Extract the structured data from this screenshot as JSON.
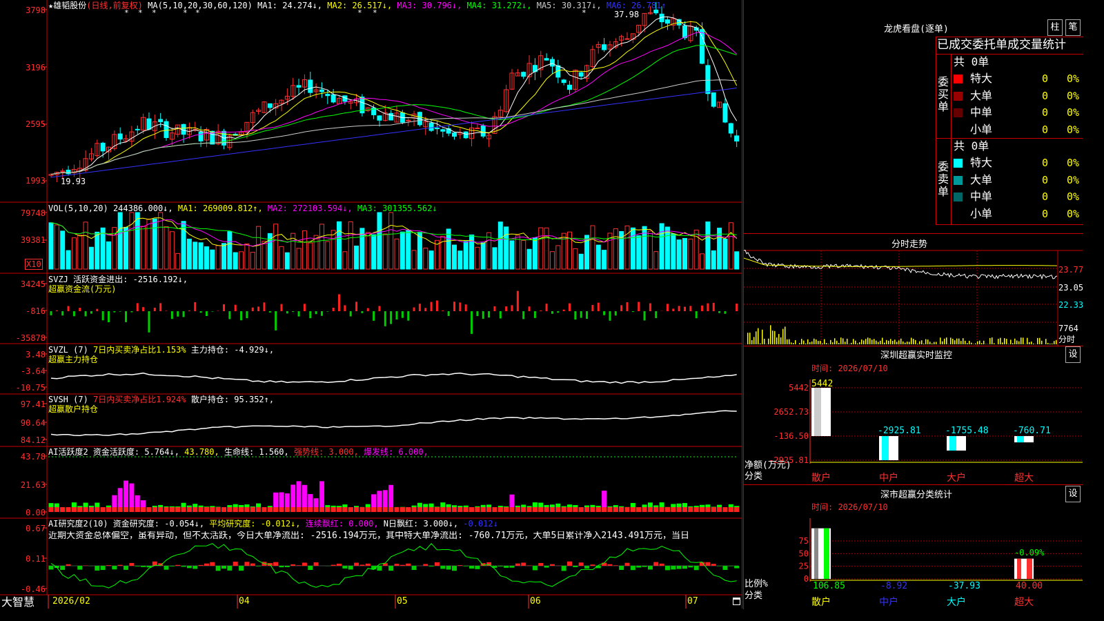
{
  "stock": {
    "name": "★雄韬股份",
    "period": "(日线,前复权)"
  },
  "main_header": {
    "ma_params": "MA(5,10,20,30,60,120)",
    "items": [
      {
        "label": "MA1: 24.274↓,",
        "color": "#ffffff"
      },
      {
        "label": "MA2: 26.517↓,",
        "color": "#ffff00"
      },
      {
        "label": "MA3: 30.796↓,",
        "color": "#ff00ff"
      },
      {
        "label": "MA4: 31.272↓,",
        "color": "#00ff00"
      },
      {
        "label": "MA5: 30.317↓,",
        "color": "#cccccc"
      },
      {
        "label": "MA6: 26.781↑",
        "color": "#3333ff"
      }
    ]
  },
  "main_axis": [
    "3798",
    "3196",
    "2595",
    "1993"
  ],
  "main_labels": {
    "high": "37.98",
    "low": "19.93"
  },
  "vol_header": {
    "params": "VOL(5,10,20)",
    "items": [
      {
        "label": "244386.000↓,",
        "color": "#ffffff"
      },
      {
        "label": "MA1: 269009.812↑,",
        "color": "#ffff00"
      },
      {
        "label": "MA2: 272103.594↓,",
        "color": "#ff00ff"
      },
      {
        "label": "MA3: 301355.562↓",
        "color": "#00ff00"
      }
    ]
  },
  "vol_axis": [
    "79748",
    "39381"
  ],
  "vol_unit": "X10",
  "svzj": {
    "line1": "SVZJ  活跃资金进出: -2516.192↓,",
    "line2": "超赢资金流(万元)",
    "axis": [
      "34245",
      "-816",
      "-35878"
    ]
  },
  "svzl": {
    "p1": "SVZL (7)",
    "p2": "7日内买卖净占比1.153%",
    "p3": "主力持仓: -4.929↓,",
    "line2": "超赢主力持仓",
    "axis": [
      "3.48",
      "-3.64",
      "-10.75"
    ]
  },
  "svsh": {
    "p1": "SVSH (7)",
    "p2": "7日内买卖净占比1.924%",
    "p3": "散户持仓: 95.352↑,",
    "line2": "超赢散户持仓",
    "axis": [
      "97.41",
      "90.64",
      "84.12"
    ]
  },
  "ai_active": {
    "items": [
      {
        "label": "AI活跃度2 资金活跃度: 5.764↓,",
        "color": "#ffffff"
      },
      {
        "label": "43.780,",
        "color": "#ffff00"
      },
      {
        "label": "生命线: 1.560,",
        "color": "#ffffff"
      },
      {
        "label": "强势线: 3.000,",
        "color": "#ff3030"
      },
      {
        "label": "爆发线: 6.000,",
        "color": "#ff00ff"
      }
    ],
    "axis": [
      "43.78",
      "21.63",
      "0.00"
    ]
  },
  "ai_research": {
    "items": [
      {
        "label": "AI研究度2(10) 资金研究度: -0.054↓,",
        "color": "#ffffff"
      },
      {
        "label": "平均研究度: -0.012↓,",
        "color": "#ffff00"
      },
      {
        "label": "连续飘红: 0.000,",
        "color": "#ff00ff"
      },
      {
        "label": "N日飘红: 3.000↓,",
        "color": "#ffffff"
      },
      {
        "label": "-0.012↓",
        "color": "#3333ff"
      }
    ],
    "comment": "近期大资金总体偏空，虽有异动，但不太活跃，今日大单净流出: -2516.194万元，其中特大单净流出: -760.71万元，大单5日累计净入2143.491万元，当日",
    "axis": [
      "0.67",
      "0.11",
      "-0.46"
    ]
  },
  "bottom_axis": {
    "brand": "大智慧",
    "months": [
      "2026/02",
      "04",
      "05",
      "06",
      "07"
    ]
  },
  "dragon": {
    "title": "龙虎看盘(逐单)",
    "btn_bar": "柱",
    "btn_pen": "笔",
    "header": "已成交委托单成交量统计",
    "buy_label": "委买单",
    "sell_label": "委卖单",
    "buy_total": "共 0单",
    "sell_total": "共 0单",
    "buy_rows": [
      {
        "label": "特大",
        "val": "0",
        "pct": "0%",
        "color": "#ff0000"
      },
      {
        "label": "大单",
        "val": "0",
        "pct": "0%",
        "color": "#990000"
      },
      {
        "label": "中单",
        "val": "0",
        "pct": "0%",
        "color": "#660000"
      },
      {
        "label": "小单",
        "val": "0",
        "pct": "0%",
        "color": ""
      }
    ],
    "sell_rows": [
      {
        "label": "特大",
        "val": "0",
        "pct": "0%",
        "color": "#00ffff"
      },
      {
        "label": "大单",
        "val": "0",
        "pct": "0%",
        "color": "#009999"
      },
      {
        "label": "中单",
        "val": "0",
        "pct": "0%",
        "color": "#006666"
      },
      {
        "label": "小单",
        "val": "0",
        "pct": "0%",
        "color": ""
      }
    ]
  },
  "intraday": {
    "title": "分时走势",
    "axis": [
      "23.77",
      "23.05",
      "22.33",
      "7764",
      "分时"
    ]
  },
  "sz_monitor": {
    "title": "深圳超赢实时监控",
    "btn": "设",
    "date": "时间: 2026/07/10",
    "unit": "净额(万元)",
    "cat_label": "分类",
    "axis": [
      "5442",
      "2652.73",
      "-136.50",
      "-2925.81"
    ],
    "bars": [
      {
        "cat": "散户",
        "value": 5442,
        "label": "5442",
        "color": "#cccccc",
        "cat_color": "#ff3030"
      },
      {
        "cat": "中户",
        "value": -2925.81,
        "label": "-2925.81",
        "color": "#00ffff",
        "cat_color": "#ff3030"
      },
      {
        "cat": "大户",
        "value": -1755.48,
        "label": "-1755.48",
        "color": "#00ffff",
        "cat_color": "#ff3030"
      },
      {
        "cat": "超大",
        "value": -760.71,
        "label": "-760.71",
        "color": "#00ffff",
        "cat_color": "#ff3030"
      }
    ]
  },
  "sz_class": {
    "title": "深市超赢分类统计",
    "btn": "设",
    "date": "时间: 2026/07/10",
    "unit": "比例%",
    "cat_label": "分类",
    "axis": [
      "75",
      "50",
      "25",
      "0"
    ],
    "extra_label": "-0.09%",
    "bars": [
      {
        "cat": "散户",
        "value": 106.85,
        "label": "106.85",
        "color": "#00ff00",
        "cat_color": "#ffff00"
      },
      {
        "cat": "中户",
        "value": -8.92,
        "label": "-8.92",
        "color": "#3333ff",
        "cat_color": "#3333ff"
      },
      {
        "cat": "大户",
        "value": -37.93,
        "label": "-37.93",
        "color": "#00ffff",
        "cat_color": "#00ffff"
      },
      {
        "cat": "超大",
        "value": 40.0,
        "label": "40.00",
        "color": "#ff3030",
        "cat_color": "#ff3030"
      }
    ]
  },
  "colors": {
    "up": "#ff3030",
    "down": "#00ffff",
    "border": "#cc0000",
    "ma1": "#ffffff",
    "ma2": "#ffff00",
    "ma3": "#ff00ff",
    "ma4": "#00ff00",
    "ma5": "#cccccc",
    "ma6": "#3333ff"
  }
}
